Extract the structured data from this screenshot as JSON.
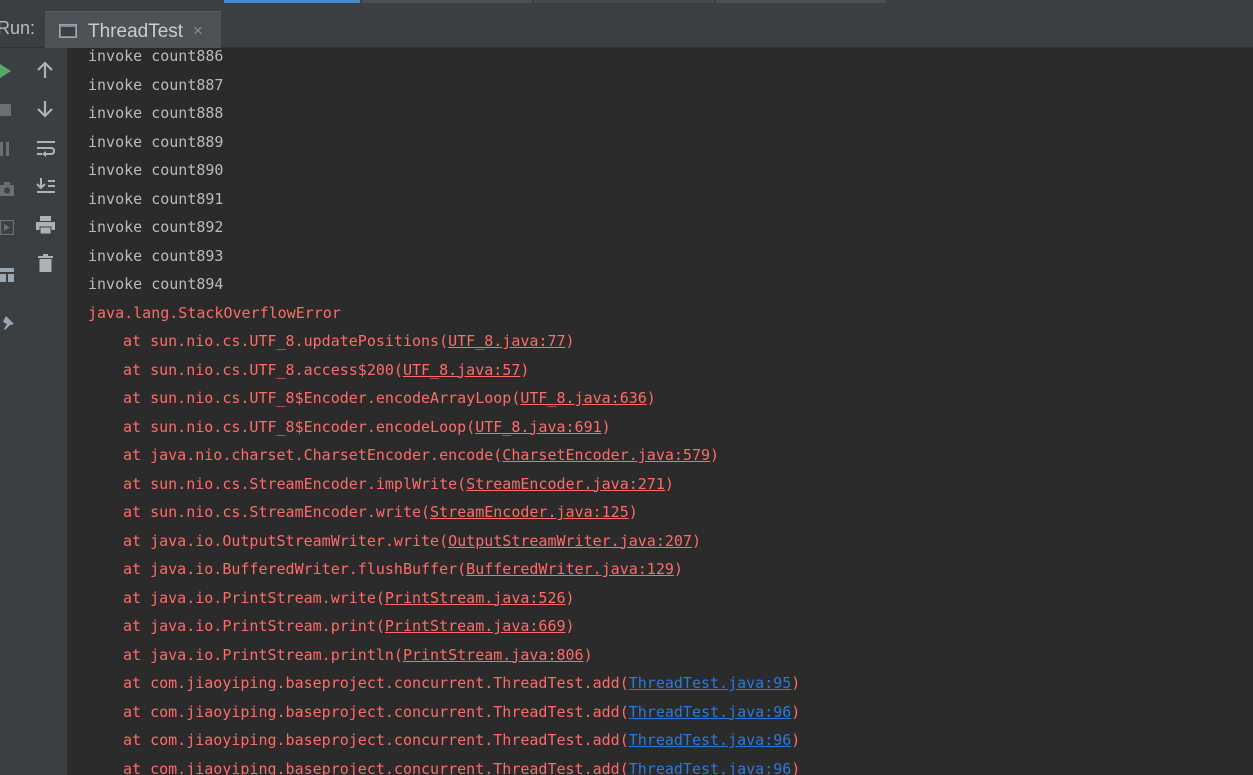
{
  "window": {
    "run_label": "Run:",
    "tab_title": "ThreadTest",
    "tab_close": "×",
    "icons": {
      "tab": "console-icon",
      "left": [
        "rerun-icon",
        "stop-icon",
        "pause-icon",
        "camera-icon",
        "exit-icon",
        "layout-icon",
        "pin-icon"
      ],
      "toolbar": [
        "arrow-up-icon",
        "arrow-down-icon",
        "soft-wrap-icon",
        "scroll-to-end-icon",
        "print-icon",
        "trash-icon"
      ]
    }
  },
  "console": {
    "output_lines": [
      "invoke count886",
      "invoke count887",
      "invoke count888",
      "invoke count889",
      "invoke count890",
      "invoke count891",
      "invoke count892",
      "invoke count893",
      "invoke count894"
    ],
    "exception": "java.lang.StackOverflowError",
    "stack_frames": [
      {
        "prefix": "at sun.nio.cs.UTF_8.updatePositions(",
        "link": "UTF_8.java:77",
        "suffix": ")",
        "user": false
      },
      {
        "prefix": "at sun.nio.cs.UTF_8.access$200(",
        "link": "UTF_8.java:57",
        "suffix": ")",
        "user": false
      },
      {
        "prefix": "at sun.nio.cs.UTF_8$Encoder.encodeArrayLoop(",
        "link": "UTF_8.java:636",
        "suffix": ")",
        "user": false
      },
      {
        "prefix": "at sun.nio.cs.UTF_8$Encoder.encodeLoop(",
        "link": "UTF_8.java:691",
        "suffix": ")",
        "user": false
      },
      {
        "prefix": "at java.nio.charset.CharsetEncoder.encode(",
        "link": "CharsetEncoder.java:579",
        "suffix": ")",
        "user": false
      },
      {
        "prefix": "at sun.nio.cs.StreamEncoder.implWrite(",
        "link": "StreamEncoder.java:271",
        "suffix": ")",
        "user": false
      },
      {
        "prefix": "at sun.nio.cs.StreamEncoder.write(",
        "link": "StreamEncoder.java:125",
        "suffix": ")",
        "user": false
      },
      {
        "prefix": "at java.io.OutputStreamWriter.write(",
        "link": "OutputStreamWriter.java:207",
        "suffix": ")",
        "user": false
      },
      {
        "prefix": "at java.io.BufferedWriter.flushBuffer(",
        "link": "BufferedWriter.java:129",
        "suffix": ")",
        "user": false
      },
      {
        "prefix": "at java.io.PrintStream.write(",
        "link": "PrintStream.java:526",
        "suffix": ")",
        "user": false
      },
      {
        "prefix": "at java.io.PrintStream.print(",
        "link": "PrintStream.java:669",
        "suffix": ")",
        "user": false
      },
      {
        "prefix": "at java.io.PrintStream.println(",
        "link": "PrintStream.java:806",
        "suffix": ")",
        "user": false
      },
      {
        "prefix": "at com.jiaoyiping.baseproject.concurrent.ThreadTest.add(",
        "link": "ThreadTest.java:95",
        "suffix": ")",
        "user": true
      },
      {
        "prefix": "at com.jiaoyiping.baseproject.concurrent.ThreadTest.add(",
        "link": "ThreadTest.java:96",
        "suffix": ")",
        "user": true
      },
      {
        "prefix": "at com.jiaoyiping.baseproject.concurrent.ThreadTest.add(",
        "link": "ThreadTest.java:96",
        "suffix": ")",
        "user": true
      },
      {
        "prefix": "at com.jiaoyiping.baseproject.concurrent.ThreadTest.add(",
        "link": "ThreadTest.java:96",
        "suffix": ")",
        "user": true
      }
    ]
  },
  "colors": {
    "background": "#2b2b2b",
    "normal_text": "#bbbbbb",
    "error_text": "#ff6b68",
    "user_link": "#287bde",
    "rerun_green": "#59a869"
  }
}
